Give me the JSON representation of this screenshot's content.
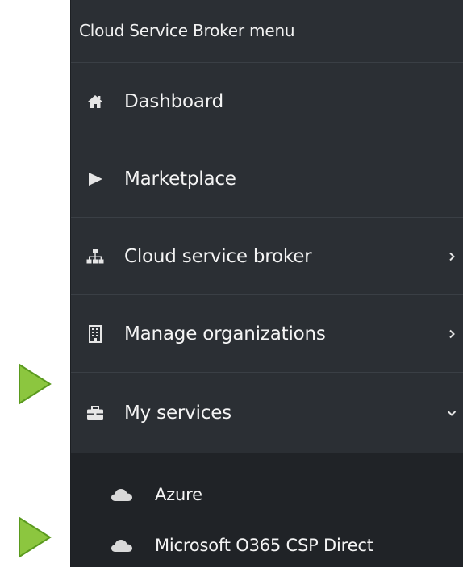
{
  "menu": {
    "title": "Cloud Service Broker menu",
    "items": [
      {
        "label": "Dashboard",
        "icon": "home-icon",
        "chevron": ""
      },
      {
        "label": "Marketplace",
        "icon": "play-icon",
        "chevron": ""
      },
      {
        "label": "Cloud service broker",
        "icon": "sitemap-icon",
        "chevron": "right"
      },
      {
        "label": "Manage organizations",
        "icon": "building-icon",
        "chevron": "right"
      },
      {
        "label": "My services",
        "icon": "briefcase-icon",
        "chevron": "down"
      }
    ],
    "sub_items": [
      {
        "label": "Azure",
        "icon": "cloud-icon"
      },
      {
        "label": "Microsoft O365 CSP Direct",
        "icon": "cloud-icon"
      }
    ]
  },
  "colors": {
    "menu_background": "#2b2f34",
    "submenu_background": "#202327",
    "text": "#f4f4f4",
    "pointer_fill": "#8cc63f",
    "pointer_stroke": "#5a9a1e"
  },
  "pointers": {
    "icon": "green-arrow-pointer-icon",
    "targets": [
      "My services",
      "Microsoft O365 CSP Direct"
    ]
  }
}
